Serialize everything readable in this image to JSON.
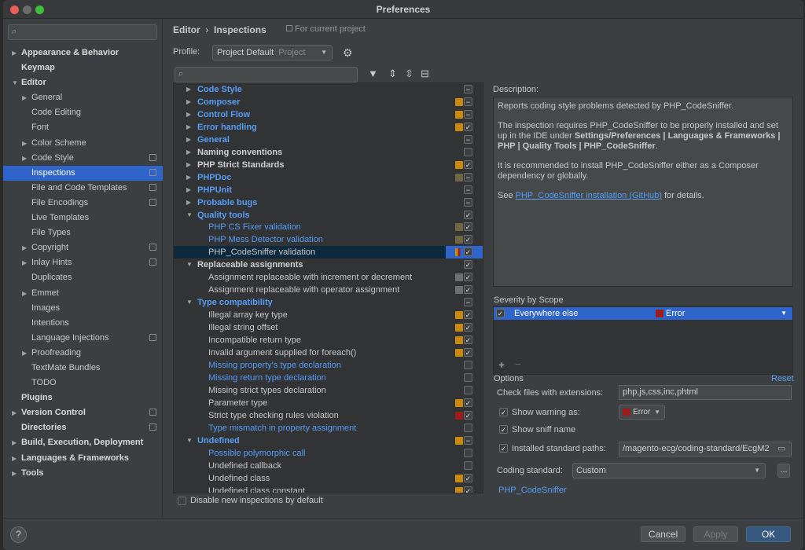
{
  "window": {
    "title": "Preferences"
  },
  "sidebar": {
    "items": [
      {
        "label": "Appearance & Behavior",
        "level": 0,
        "arrow": "right",
        "bold": true
      },
      {
        "label": "Keymap",
        "level": 0,
        "bold": true
      },
      {
        "label": "Editor",
        "level": 0,
        "arrow": "down",
        "bold": true
      },
      {
        "label": "General",
        "level": 1,
        "arrow": "right"
      },
      {
        "label": "Code Editing",
        "level": 1
      },
      {
        "label": "Font",
        "level": 1
      },
      {
        "label": "Color Scheme",
        "level": 1,
        "arrow": "right"
      },
      {
        "label": "Code Style",
        "level": 1,
        "arrow": "right",
        "copy": true
      },
      {
        "label": "Inspections",
        "level": 1,
        "copy": true,
        "selected": true
      },
      {
        "label": "File and Code Templates",
        "level": 1,
        "copy": true
      },
      {
        "label": "File Encodings",
        "level": 1,
        "copy": true
      },
      {
        "label": "Live Templates",
        "level": 1
      },
      {
        "label": "File Types",
        "level": 1
      },
      {
        "label": "Copyright",
        "level": 1,
        "arrow": "right",
        "copy": true
      },
      {
        "label": "Inlay Hints",
        "level": 1,
        "arrow": "right",
        "copy": true
      },
      {
        "label": "Duplicates",
        "level": 1
      },
      {
        "label": "Emmet",
        "level": 1,
        "arrow": "right"
      },
      {
        "label": "Images",
        "level": 1
      },
      {
        "label": "Intentions",
        "level": 1
      },
      {
        "label": "Language Injections",
        "level": 1,
        "copy": true
      },
      {
        "label": "Proofreading",
        "level": 1,
        "arrow": "right"
      },
      {
        "label": "TextMate Bundles",
        "level": 1
      },
      {
        "label": "TODO",
        "level": 1
      },
      {
        "label": "Plugins",
        "level": 0,
        "bold": true
      },
      {
        "label": "Version Control",
        "level": 0,
        "arrow": "right",
        "bold": true,
        "copy": true
      },
      {
        "label": "Directories",
        "level": 0,
        "bold": true,
        "copy": true
      },
      {
        "label": "Build, Execution, Deployment",
        "level": 0,
        "arrow": "right",
        "bold": true
      },
      {
        "label": "Languages & Frameworks",
        "level": 0,
        "arrow": "right",
        "bold": true
      },
      {
        "label": "Tools",
        "level": 0,
        "arrow": "right",
        "bold": true
      }
    ]
  },
  "header": {
    "breadcrumb_1": "Editor",
    "breadcrumb_sep": "›",
    "breadcrumb_2": "Inspections",
    "for_current_project": "For current project",
    "profile_label": "Profile:",
    "profile_value": "Project Default",
    "profile_hint": "Project"
  },
  "inspections": [
    {
      "label": "Code Style",
      "level": 0,
      "arrow": "right",
      "style": "grp-b",
      "sw": null,
      "cb": "minus"
    },
    {
      "label": "Composer",
      "level": 0,
      "arrow": "right",
      "style": "grp-b",
      "sw": "#c98a0f",
      "cb": "minus"
    },
    {
      "label": "Control Flow",
      "level": 0,
      "arrow": "right",
      "style": "grp-b",
      "sw": "#c98a0f",
      "cb": "minus"
    },
    {
      "label": "Error handling",
      "level": 0,
      "arrow": "right",
      "style": "grp-b",
      "sw": "#c98a0f",
      "cb": "check"
    },
    {
      "label": "General",
      "level": 0,
      "arrow": "right",
      "style": "grp-b",
      "sw": null,
      "cb": "minus"
    },
    {
      "label": "Naming conventions",
      "level": 0,
      "arrow": "right",
      "style": "grp-w",
      "sw": null,
      "cb": "none"
    },
    {
      "label": "PHP Strict Standards",
      "level": 0,
      "arrow": "right",
      "style": "grp-w",
      "sw": "#c98a0f",
      "cb": "check"
    },
    {
      "label": "PHPDoc",
      "level": 0,
      "arrow": "right",
      "style": "grp-b",
      "sw": "#6e6743",
      "cb": "minus"
    },
    {
      "label": "PHPUnit",
      "level": 0,
      "arrow": "right",
      "style": "grp-b",
      "sw": null,
      "cb": "minus"
    },
    {
      "label": "Probable bugs",
      "level": 0,
      "arrow": "right",
      "style": "grp-b",
      "sw": null,
      "cb": "minus"
    },
    {
      "label": "Quality tools",
      "level": 0,
      "arrow": "down",
      "style": "grp-b",
      "sw": null,
      "cb": "check"
    },
    {
      "label": "PHP CS Fixer validation",
      "level": 1,
      "style": "blue",
      "sw": "#6e6743",
      "cb": "check"
    },
    {
      "label": "PHP Mess Detector validation",
      "level": 1,
      "style": "blue",
      "sw": "#6e6743",
      "cb": "check"
    },
    {
      "label": "PHP_CodeSniffer validation",
      "level": 1,
      "style": "",
      "sw": "#9b1c1c",
      "cb": "check",
      "selected": true
    },
    {
      "label": "Replaceable assignments",
      "level": 0,
      "arrow": "down",
      "style": "grp-w",
      "sw": null,
      "cb": "check"
    },
    {
      "label": "Assignment replaceable with increment or decrement",
      "level": 1,
      "style": "",
      "sw": "#6f6f6f",
      "cb": "check"
    },
    {
      "label": "Assignment replaceable with operator assignment",
      "level": 1,
      "style": "",
      "sw": "#6f6f6f",
      "cb": "check"
    },
    {
      "label": "Type compatibility",
      "level": 0,
      "arrow": "down",
      "style": "grp-b",
      "sw": null,
      "cb": "minus"
    },
    {
      "label": "Illegal array key type",
      "level": 1,
      "style": "",
      "sw": "#c98a0f",
      "cb": "check"
    },
    {
      "label": "Illegal string offset",
      "level": 1,
      "style": "",
      "sw": "#c98a0f",
      "cb": "check"
    },
    {
      "label": "Incompatible return type",
      "level": 1,
      "style": "",
      "sw": "#c98a0f",
      "cb": "check"
    },
    {
      "label": "Invalid argument supplied for foreach()",
      "level": 1,
      "style": "",
      "sw": "#c98a0f",
      "cb": "check"
    },
    {
      "label": "Missing property's type declaration",
      "level": 1,
      "style": "blue",
      "sw": null,
      "cb": "none"
    },
    {
      "label": "Missing return type declaration",
      "level": 1,
      "style": "blue",
      "sw": null,
      "cb": "none"
    },
    {
      "label": "Missing strict types declaration",
      "level": 1,
      "style": "",
      "sw": null,
      "cb": "none"
    },
    {
      "label": "Parameter type",
      "level": 1,
      "style": "",
      "sw": "#c98a0f",
      "cb": "check"
    },
    {
      "label": "Strict type checking rules violation",
      "level": 1,
      "style": "",
      "sw": "#9b1c1c",
      "cb": "check"
    },
    {
      "label": "Type mismatch in property assignment",
      "level": 1,
      "style": "blue",
      "sw": null,
      "cb": "none"
    },
    {
      "label": "Undefined",
      "level": 0,
      "arrow": "down",
      "style": "grp-b",
      "sw": "#c98a0f",
      "cb": "minus"
    },
    {
      "label": "Possible polymorphic call",
      "level": 1,
      "style": "blue",
      "sw": null,
      "cb": "none"
    },
    {
      "label": "Undefined callback",
      "level": 1,
      "style": "",
      "sw": null,
      "cb": "none"
    },
    {
      "label": "Undefined class",
      "level": 1,
      "style": "",
      "sw": "#c98a0f",
      "cb": "check"
    },
    {
      "label": "Undefined class constant",
      "level": 1,
      "style": "",
      "sw": "#c98a0f",
      "cb": "check"
    }
  ],
  "disable_new_label": "Disable new inspections by default",
  "description": {
    "label": "Description:",
    "p1": "Reports coding style problems detected by PHP_CodeSniffer.",
    "p2a": "The inspection requires PHP_CodeSniffer to be properly installed and set up in the IDE under ",
    "p2b": "Settings/Preferences | Languages & Frameworks | PHP | Quality Tools | PHP_CodeSniffer",
    "p2c": ".",
    "p3": "It is recommended to install PHP_CodeSniffer either as a Composer dependency or globally.",
    "p4a": "See ",
    "p4link": "PHP_CodeSniffer installation (GitHub)",
    "p4b": " for details."
  },
  "severity": {
    "label": "Severity by Scope",
    "scope": "Everywhere else",
    "level": "Error",
    "add": "+",
    "remove": "−"
  },
  "options": {
    "label": "Options",
    "reset": "Reset",
    "ext_label": "Check files with extensions:",
    "ext_value": "php,js,css,inc,phtml",
    "show_warning": "Show warning as:",
    "warning_value": "Error",
    "show_sniff": "Show sniff name",
    "installed": "Installed standard paths:",
    "installed_value": "/magento-ecg/coding-standard/EcgM2",
    "coding_label": "Coding standard:",
    "coding_value": "Custom",
    "more": "...",
    "link": "PHP_CodeSniffer"
  },
  "buttons": {
    "help": "?",
    "cancel": "Cancel",
    "apply": "Apply",
    "ok": "OK"
  },
  "colors": {
    "accent": "#2f65ca",
    "link": "#589df6",
    "error": "#9b1c1c",
    "warning": "#c98a0f"
  }
}
